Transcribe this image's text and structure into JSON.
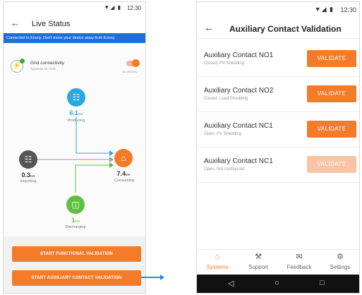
{
  "left": {
    "status_time": "12:30",
    "status_icons": "▼◢ ▮",
    "back_icon": "arrow-left-icon",
    "title": "Live Status",
    "banner": "Connected to Envoy. Don't move your device away from Envoy.",
    "grid": {
      "name": "Grid connectivity",
      "subtitle": "Systemis On-Grid",
      "toggle_label": "Go Off-Grid",
      "toggle_on": true
    },
    "flow": {
      "producing": {
        "value": "6.1",
        "unit": "kW",
        "label": "Producing"
      },
      "importing": {
        "value": "0.3",
        "unit": "kW",
        "label": "Importing"
      },
      "consuming": {
        "value": "7.4",
        "unit": "kW",
        "label": "Consuming"
      },
      "discharging": {
        "value": "1",
        "unit": "kW",
        "label": "Discharging"
      }
    },
    "buttons": {
      "functional": "START FUNCTIONAL VALIDATION",
      "auxiliary": "START AUXILIARY CONTACT VALIDATION"
    }
  },
  "right": {
    "status_time": "12:30",
    "status_icons": "▼◢ ▮",
    "back_icon": "arrow-left-icon",
    "title": "Auxiliary Contact Validation",
    "contacts": [
      {
        "name": "Auxiliary Contact NO1",
        "status": "Closed, PV Shedding",
        "button": "VALIDATE",
        "enabled": true
      },
      {
        "name": "Auxiliary Contact NO2",
        "status": "Closed, Load Shedding",
        "button": "VALIDATE",
        "enabled": true
      },
      {
        "name": "Auxiliary Contact NC1",
        "status": "Open, PV Shedding",
        "button": "VALIDATE",
        "enabled": true
      },
      {
        "name": "Auxiliary Contact NC1",
        "status": "Open, Not configured",
        "button": "VALIDATE",
        "enabled": false
      }
    ],
    "tabs": [
      {
        "label": "Systems",
        "icon": "home-icon",
        "active": true
      },
      {
        "label": "Support",
        "icon": "wrench-icon",
        "active": false
      },
      {
        "label": "Feedback",
        "icon": "feedback-icon",
        "active": false
      },
      {
        "label": "Settings",
        "icon": "gear-icon",
        "active": false
      }
    ]
  },
  "colors": {
    "accent": "#f47b2a",
    "banner": "#1e6fd8",
    "solar": "#29a9df",
    "battery": "#5fbf3f",
    "grid": "#555555"
  }
}
